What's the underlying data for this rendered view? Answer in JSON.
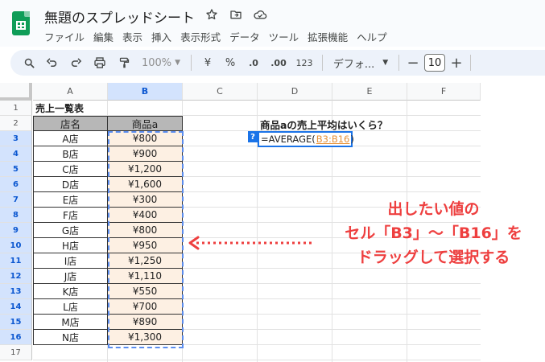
{
  "app": {
    "doc_title": "無題のスプレッドシート",
    "menu": [
      "ファイル",
      "編集",
      "表示",
      "挿入",
      "表示形式",
      "データ",
      "ツール",
      "拡張機能",
      "ヘルプ"
    ]
  },
  "toolbar": {
    "zoom": "100%",
    "currency": "¥",
    "percent": "%",
    "dec_decrease": ".0",
    "dec_increase": ".00",
    "number_format": "123",
    "font": "デフォ...",
    "font_size": "10",
    "minus": "−",
    "plus": "+"
  },
  "grid": {
    "columns": [
      "A",
      "B",
      "C",
      "D",
      "E",
      "F"
    ],
    "rows": [
      "1",
      "2",
      "3",
      "4",
      "5",
      "6",
      "7",
      "8",
      "9",
      "10",
      "11",
      "12",
      "13",
      "14",
      "15",
      "16",
      "17"
    ]
  },
  "sheet": {
    "title": "売上一覧表",
    "header_store": "店名",
    "header_product": "商品a",
    "rows": [
      {
        "store": "A店",
        "price": "¥800"
      },
      {
        "store": "B店",
        "price": "¥900"
      },
      {
        "store": "C店",
        "price": "¥1,200"
      },
      {
        "store": "D店",
        "price": "¥1,600"
      },
      {
        "store": "E店",
        "price": "¥300"
      },
      {
        "store": "F店",
        "price": "¥400"
      },
      {
        "store": "G店",
        "price": "¥800"
      },
      {
        "store": "H店",
        "price": "¥950"
      },
      {
        "store": "I店",
        "price": "¥1,250"
      },
      {
        "store": "J店",
        "price": "¥1,110"
      },
      {
        "store": "K店",
        "price": "¥550"
      },
      {
        "store": "L店",
        "price": "¥700"
      },
      {
        "store": "M店",
        "price": "¥890"
      },
      {
        "store": "N店",
        "price": "¥1,300"
      }
    ],
    "question": "商品aの売上平均はいくら？",
    "formula_prefix": "=AVERAGE(",
    "formula_ref": "B3:B16",
    "formula_suffix": ")",
    "help_mark": "?"
  },
  "annotation": {
    "line1": "出したい値の",
    "line2": "セル「B3」〜「B16」を",
    "line3": "ドラッグして選択する",
    "color": "#ee3f3f"
  }
}
